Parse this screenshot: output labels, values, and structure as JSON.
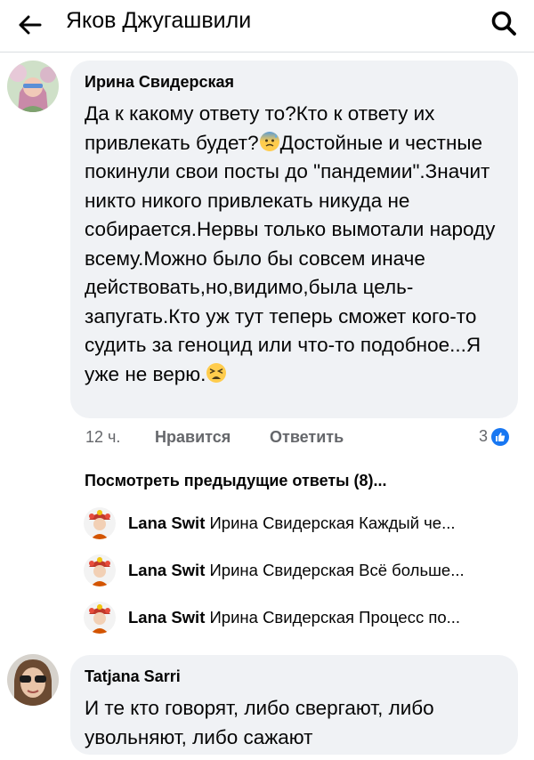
{
  "header": {
    "back_icon": "arrow-left-icon",
    "title": "Яков Джугашвили",
    "search_icon": "search-icon"
  },
  "comment": {
    "author": "Ирина Свидерская",
    "text_part1": "Да к какому ответу то?Кто к ответу их привлекать будет?",
    "emoji1": "anxious-face-with-sweat-icon",
    "text_part2": "Достойные и честные покинули свои посты до \"пандемии\".Значит никто никого привлекать никуда не собирается.Нервы только вымотали народу всему.Можно было бы совсем иначе действовать,но,видимо,была цель-запугать.Кто уж тут теперь сможет кого-то судить за геноцид или что-то подобное...Я уже не верю.",
    "emoji2": "tired-face-icon",
    "time": "12 ч.",
    "like_label": "Нравится",
    "reply_label": "Ответить",
    "reaction_count": "3",
    "reaction_icon": "like-icon"
  },
  "previous_replies_label": "Посмотреть предыдущие ответы (8)...",
  "replies": [
    {
      "author": "Lana Swit",
      "snippet": "Ирина Свидерская Каждый че..."
    },
    {
      "author": "Lana Swit",
      "snippet": "Ирина Свидерская Всё больше..."
    },
    {
      "author": "Lana Swit",
      "snippet": "Ирина Свидерская Процесс по..."
    }
  ],
  "comment2": {
    "author": "Tatjana Sarri",
    "text": "И те кто говорят, либо свергают, либо увольняют, либо сажают"
  },
  "colors": {
    "bubble": "#f0f2f5",
    "meta": "#65676b",
    "like_blue": "#1877f2"
  }
}
